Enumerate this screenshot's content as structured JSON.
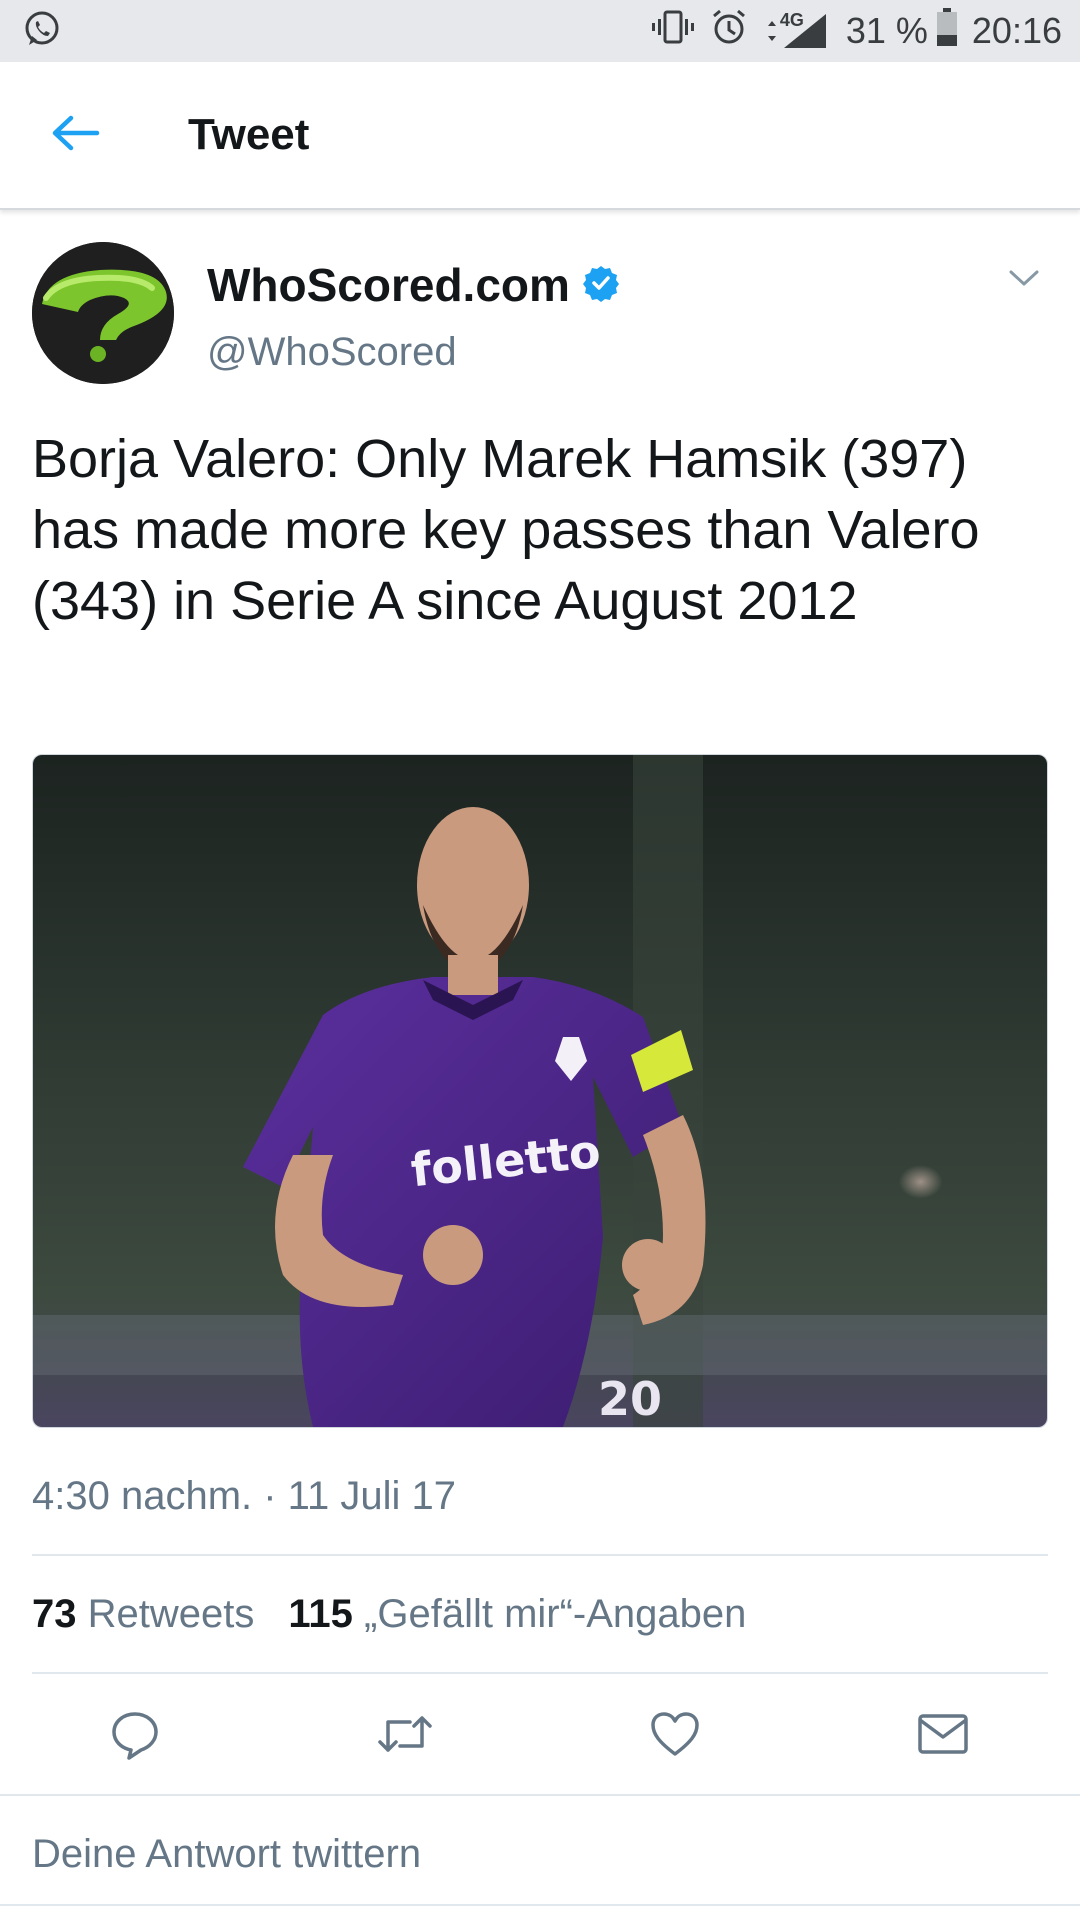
{
  "status_bar": {
    "left_icon": "whatsapp-icon",
    "network": "4G",
    "battery": "31 %",
    "time": "20:16"
  },
  "app_bar": {
    "back_icon": "arrow-left-icon",
    "title": "Tweet"
  },
  "tweet": {
    "author": {
      "display_name": "WhoScored.com",
      "handle": "@WhoScored",
      "verified": true
    },
    "text": "Borja Valero: Only Marek Hamsik (397) has made more key passes than Valero (343) in Serie A since August 2012",
    "media": {
      "jersey_sponsor": "folletto",
      "jersey_number": "20"
    },
    "timestamp": "4:30 nachm. · 11 Juli 17",
    "stats": {
      "retweets_count": "73",
      "retweets_label": "Retweets",
      "likes_count": "115",
      "likes_label": "„Gefällt mir“-Angaben"
    },
    "actions": [
      "reply-icon",
      "retweet-icon",
      "heart-icon",
      "mail-icon"
    ]
  },
  "reply_box": {
    "placeholder": "Deine Antwort twittern"
  },
  "colors": {
    "accent": "#1da1f2",
    "secondary_text": "#657786",
    "status_bar_bg": "#e6e8eb"
  }
}
